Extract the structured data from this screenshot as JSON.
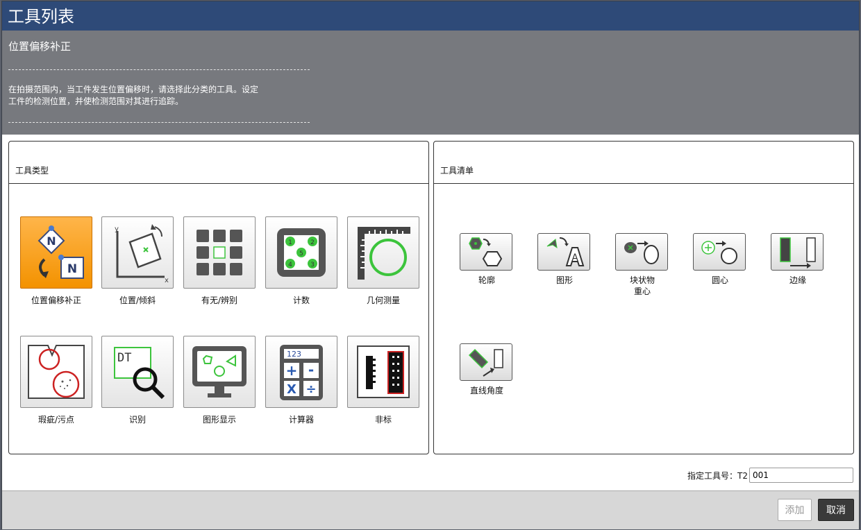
{
  "window": {
    "title": "工具列表"
  },
  "description": {
    "heading": "位置偏移补正",
    "line1": "在拍摄范围内，当工件发生位置偏移时，请选择此分类的工具。设定",
    "line2": "工件的检测位置，并使检测范围对其进行追踪。"
  },
  "tool_types": {
    "title": "工具类型",
    "items": [
      {
        "label": "位置偏移补正",
        "icon": "position-offset-icon",
        "selected": true
      },
      {
        "label": "位置/倾斜",
        "icon": "position-tilt-icon"
      },
      {
        "label": "有无/辨别",
        "icon": "presence-grid-icon"
      },
      {
        "label": "计数",
        "icon": "count-icon"
      },
      {
        "label": "几何测量",
        "icon": "geometry-measure-icon"
      },
      {
        "label": "瑕疵/污点",
        "icon": "defect-stain-icon"
      },
      {
        "label": "识别",
        "icon": "ocr-magnifier-icon"
      },
      {
        "label": "图形显示",
        "icon": "graphic-display-icon"
      },
      {
        "label": "计算器",
        "icon": "calculator-icon"
      },
      {
        "label": "非标",
        "icon": "non-standard-icon"
      }
    ],
    "calc_digits": "123",
    "ocr_text": "DT"
  },
  "tool_list": {
    "title": "工具清单",
    "items": [
      {
        "label1": "轮廓",
        "label2": "",
        "icon": "contour-icon"
      },
      {
        "label1": "图形",
        "label2": "",
        "icon": "pattern-icon"
      },
      {
        "label1": "块状物",
        "label2": "重心",
        "icon": "blob-centroid-icon"
      },
      {
        "label1": "圆心",
        "label2": "",
        "icon": "circle-center-icon"
      },
      {
        "label1": "边缘",
        "label2": "",
        "icon": "edge-icon"
      },
      {
        "label1": "直线角度",
        "label2": "",
        "icon": "line-angle-icon"
      }
    ]
  },
  "tool_number": {
    "label": "指定工具号：T2",
    "value": "001"
  },
  "buttons": {
    "add": "添加",
    "cancel": "取消"
  },
  "colors": {
    "title_bg": "#2e4a78",
    "selected": "#f39200",
    "accent_green": "#3cc43c",
    "accent_red": "#cc2222"
  }
}
